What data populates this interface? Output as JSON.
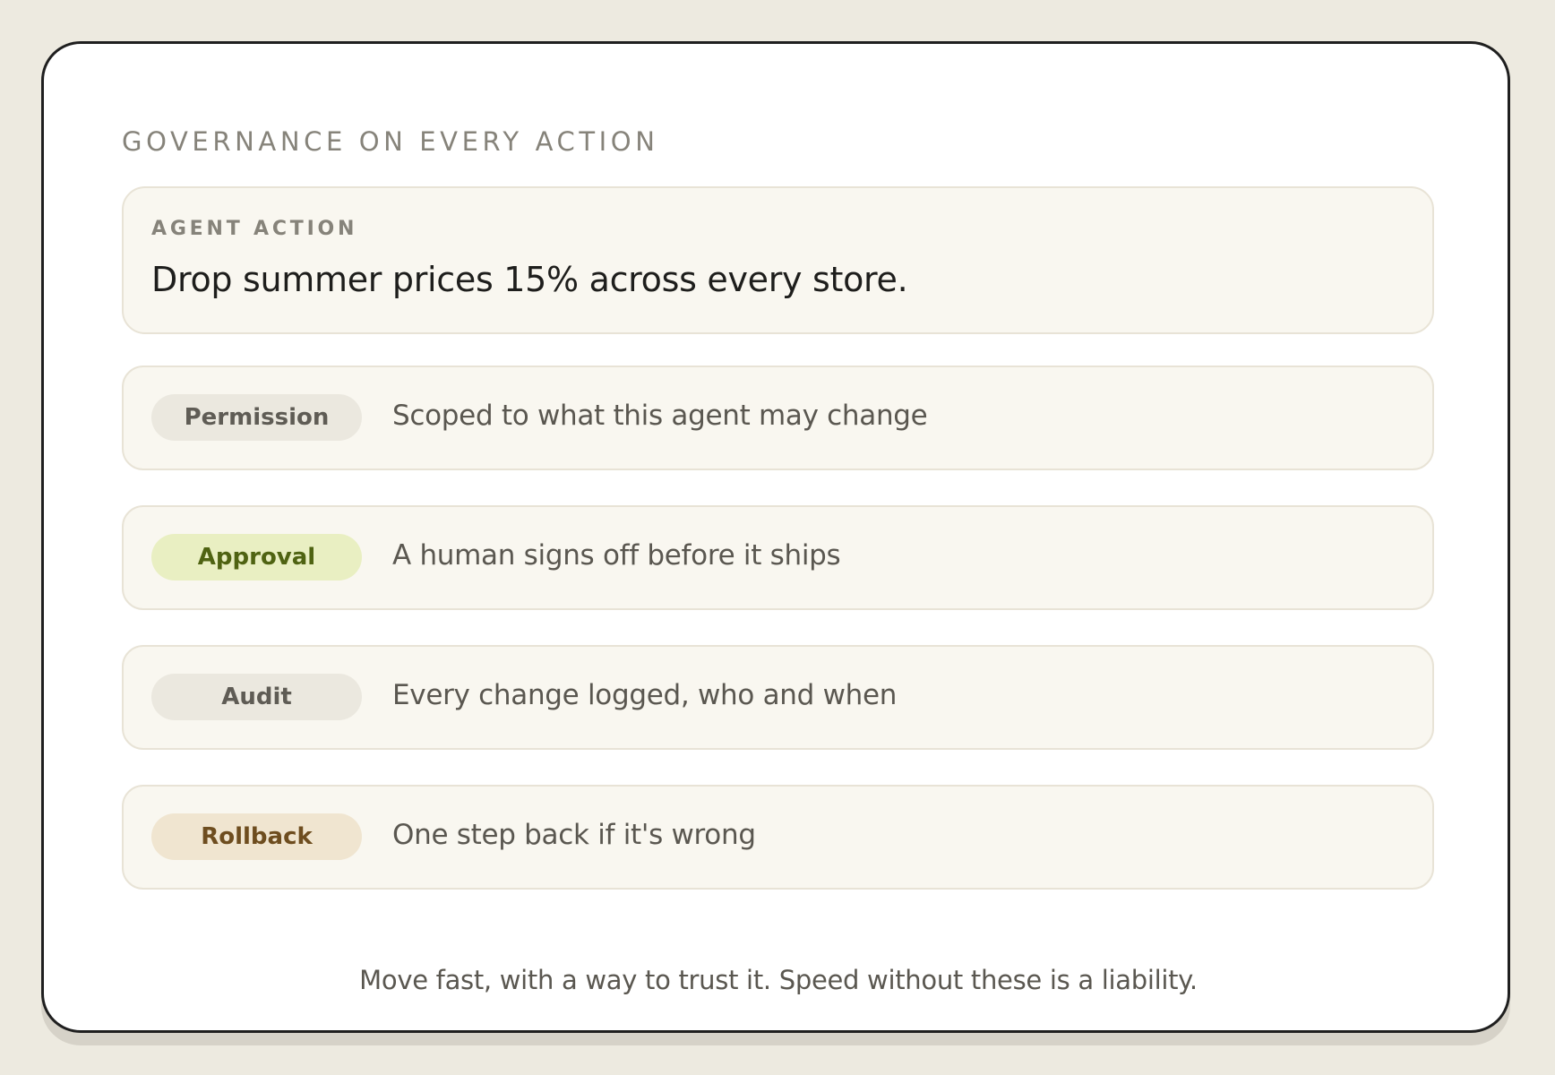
{
  "eyebrow": "GOVERNANCE ON EVERY ACTION",
  "action": {
    "label": "AGENT ACTION",
    "text": "Drop summer prices 15% across every store."
  },
  "steps": [
    {
      "tag": "Permission",
      "description": "Scoped to what this agent may change",
      "tone": "neutral"
    },
    {
      "tag": "Approval",
      "description": "A human signs off before it ships",
      "tone": "green"
    },
    {
      "tag": "Audit",
      "description": "Every change logged, who and when",
      "tone": "neutral"
    },
    {
      "tag": "Rollback",
      "description": "One step back if it's wrong",
      "tone": "tan"
    }
  ],
  "footer": "Move fast, with a way to trust it. Speed without these is a liability.",
  "colors": {
    "background": "#edeae0",
    "card": "#ffffff",
    "panel": "#f9f7f0",
    "approval_pill": "#e9efc2",
    "rollback_pill": "#f0e5d0",
    "neutral_pill": "#ebe8df"
  },
  "icons": [
    "arrow-down-icon"
  ]
}
